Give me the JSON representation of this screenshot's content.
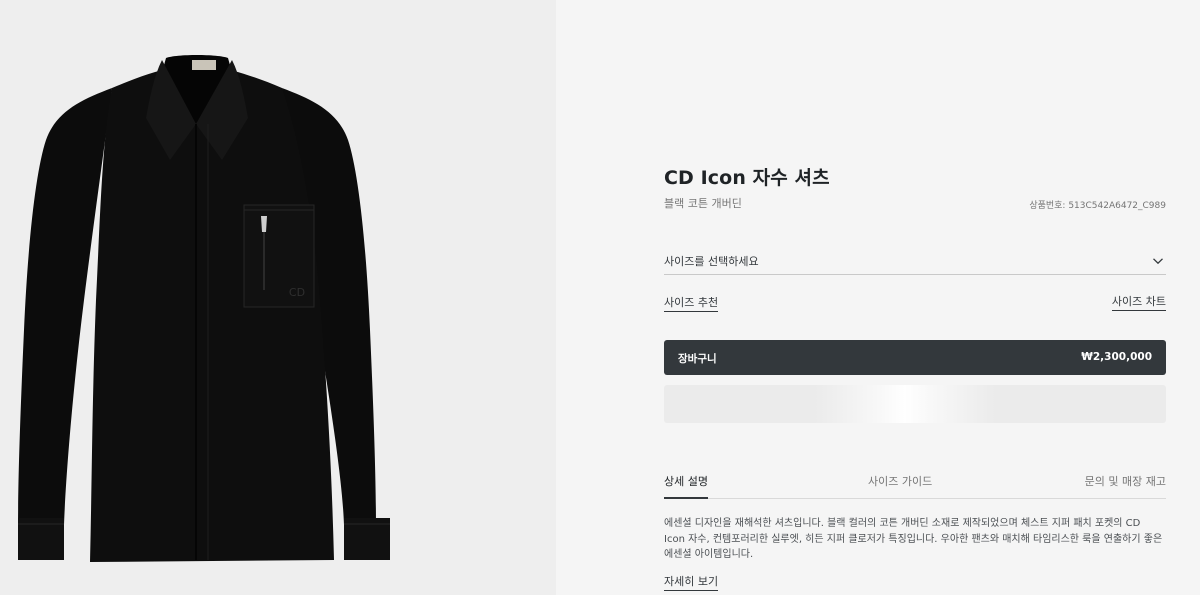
{
  "product": {
    "title": "CD Icon 자수 셔츠",
    "subtitle": "블랙 코튼 개버딘",
    "reference": "상품번호: 513C542A6472_C989"
  },
  "size_select": {
    "placeholder": "사이즈를 선택하세요",
    "icon": "chevron-down-icon"
  },
  "links": {
    "size_recommend": "사이즈 추천",
    "size_chart": "사이즈 차트",
    "read_more": "자세히 보기"
  },
  "cart": {
    "label": "장바구니",
    "price": "₩2,300,000"
  },
  "tabs": [
    {
      "label": "상세 설명",
      "active": true
    },
    {
      "label": "사이즈 가이드",
      "active": false
    },
    {
      "label": "문의 및 매장 재고",
      "active": false
    }
  ],
  "description": "에센셜 디자인을 재해석한 셔츠입니다. 블랙 컬러의 코튼 개버딘 소재로 제작되었으며 체스트 지퍼 패치 포켓의 CD Icon 자수, 컨템포러리한 실루엣, 히든 지퍼 클로저가 특징입니다. 우아한 팬츠와 매치해 타임리스한 룩을 연출하기 좋은 에센셜 아이템입니다.",
  "colors": {
    "accent": "#33383c",
    "background": "#f5f5f5",
    "image_bg": "#eeeeee"
  }
}
